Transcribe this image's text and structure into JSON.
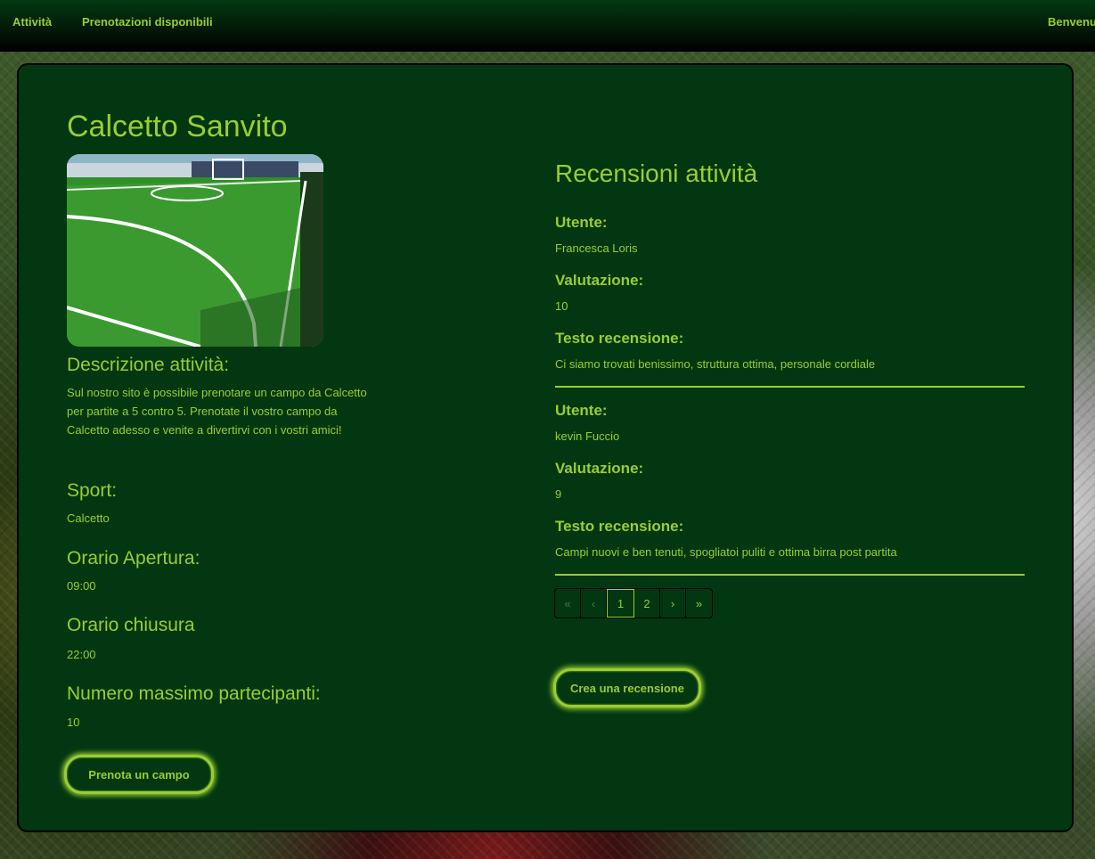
{
  "nav": {
    "activities": "Attività",
    "bookings": "Prenotazioni disponibili",
    "welcome": "Benvenu"
  },
  "activity": {
    "title": "Calcetto Sanvito",
    "description_label": "Descrizione attività:",
    "description": "Sul nostro sito è possibile prenotare un campo da Calcetto per partite a 5 contro 5. Prenotate il vostro campo da Calcetto adesso e venite a divertirvi con i vostri amici!",
    "sport_label": "Sport:",
    "sport": "Calcetto",
    "open_label": "Orario Apertura:",
    "open": "09:00",
    "close_label": "Orario chiusura",
    "close": "22:00",
    "max_label": "Numero massimo partecipanti:",
    "max": "10",
    "book_button": "Prenota un campo"
  },
  "reviews": {
    "title": "Recensioni attività",
    "user_label": "Utente:",
    "rating_label": "Valutazione:",
    "text_label": "Testo recensione:",
    "items": [
      {
        "user": "Francesca Loris",
        "rating": "10",
        "text": "Ci siamo trovati benissimo, struttura ottima, personale cordiale"
      },
      {
        "user": "kevin Fuccio",
        "rating": "9",
        "text": "Campi nuovi e ben tenuti, spogliatoi puliti e ottima birra post partita"
      }
    ],
    "pagination": {
      "first": "«",
      "prev": "‹",
      "pages": [
        "1",
        "2"
      ],
      "next": "›",
      "last": "»",
      "current": "1"
    },
    "create_button": "Crea una recensione"
  },
  "colors": {
    "accent": "#9acd32",
    "card": "#023711",
    "nav_top": "#033a12"
  }
}
